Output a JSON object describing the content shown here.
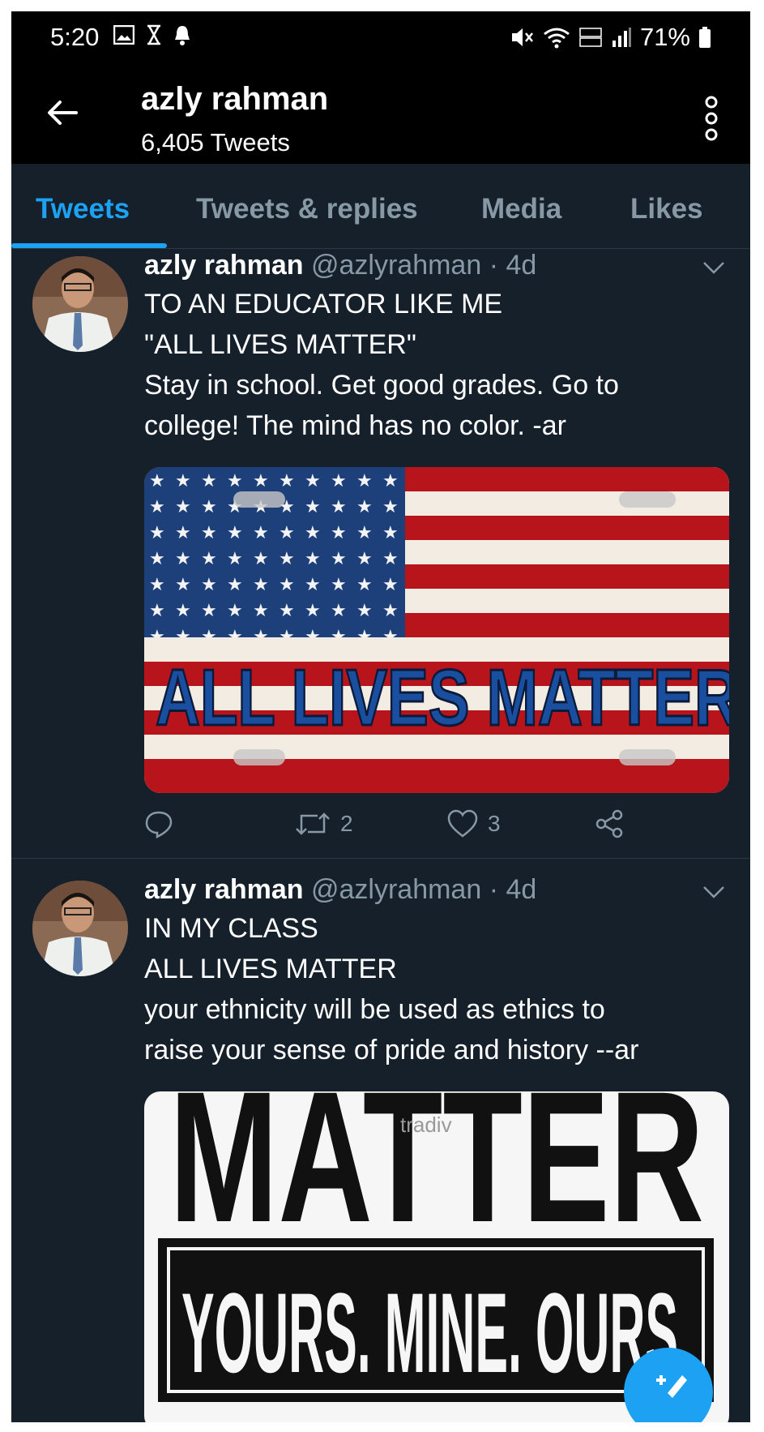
{
  "status_bar": {
    "time": "5:20",
    "battery": "71%",
    "icons_left": [
      "image-icon",
      "hourglass-icon",
      "bell-icon"
    ],
    "icons_right": [
      "mute-icon",
      "wifi-icon",
      "volte-icon",
      "signal-icon",
      "battery-icon"
    ]
  },
  "header": {
    "title": "azly rahman",
    "tweet_count": "6,405 Tweets"
  },
  "tabs": [
    {
      "label": "Tweets",
      "active": true
    },
    {
      "label": "Tweets & replies",
      "active": false
    },
    {
      "label": "Media",
      "active": false
    },
    {
      "label": "Likes",
      "active": false
    }
  ],
  "tweets": [
    {
      "name": "azly rahman",
      "handle": "@azlyrahman",
      "time": "· 4d",
      "lines": [
        "TO AN EDUCATOR LIKE ME",
        "\"ALL LIVES MATTER\"",
        "Stay in school. Get good grades. Go to",
        "college! The mind has no color. -ar"
      ],
      "media_text": "ALL LIVES MATTER",
      "retweets": "2",
      "likes": "3"
    },
    {
      "name": "azly rahman",
      "handle": "@azlyrahman",
      "time": "· 4d",
      "lines": [
        "IN MY CLASS",
        "ALL LIVES MATTER",
        "your ethnicity will be used as ethics to",
        "raise your sense of pride and history --ar"
      ],
      "media_text_top": "MATTER",
      "media_text_bottom": "YOURS. MINE. OURS.",
      "watermark": "tradiv"
    }
  ],
  "colors": {
    "background": "#15202b",
    "accent": "#1da1f2",
    "secondary_text": "#8899a6"
  }
}
